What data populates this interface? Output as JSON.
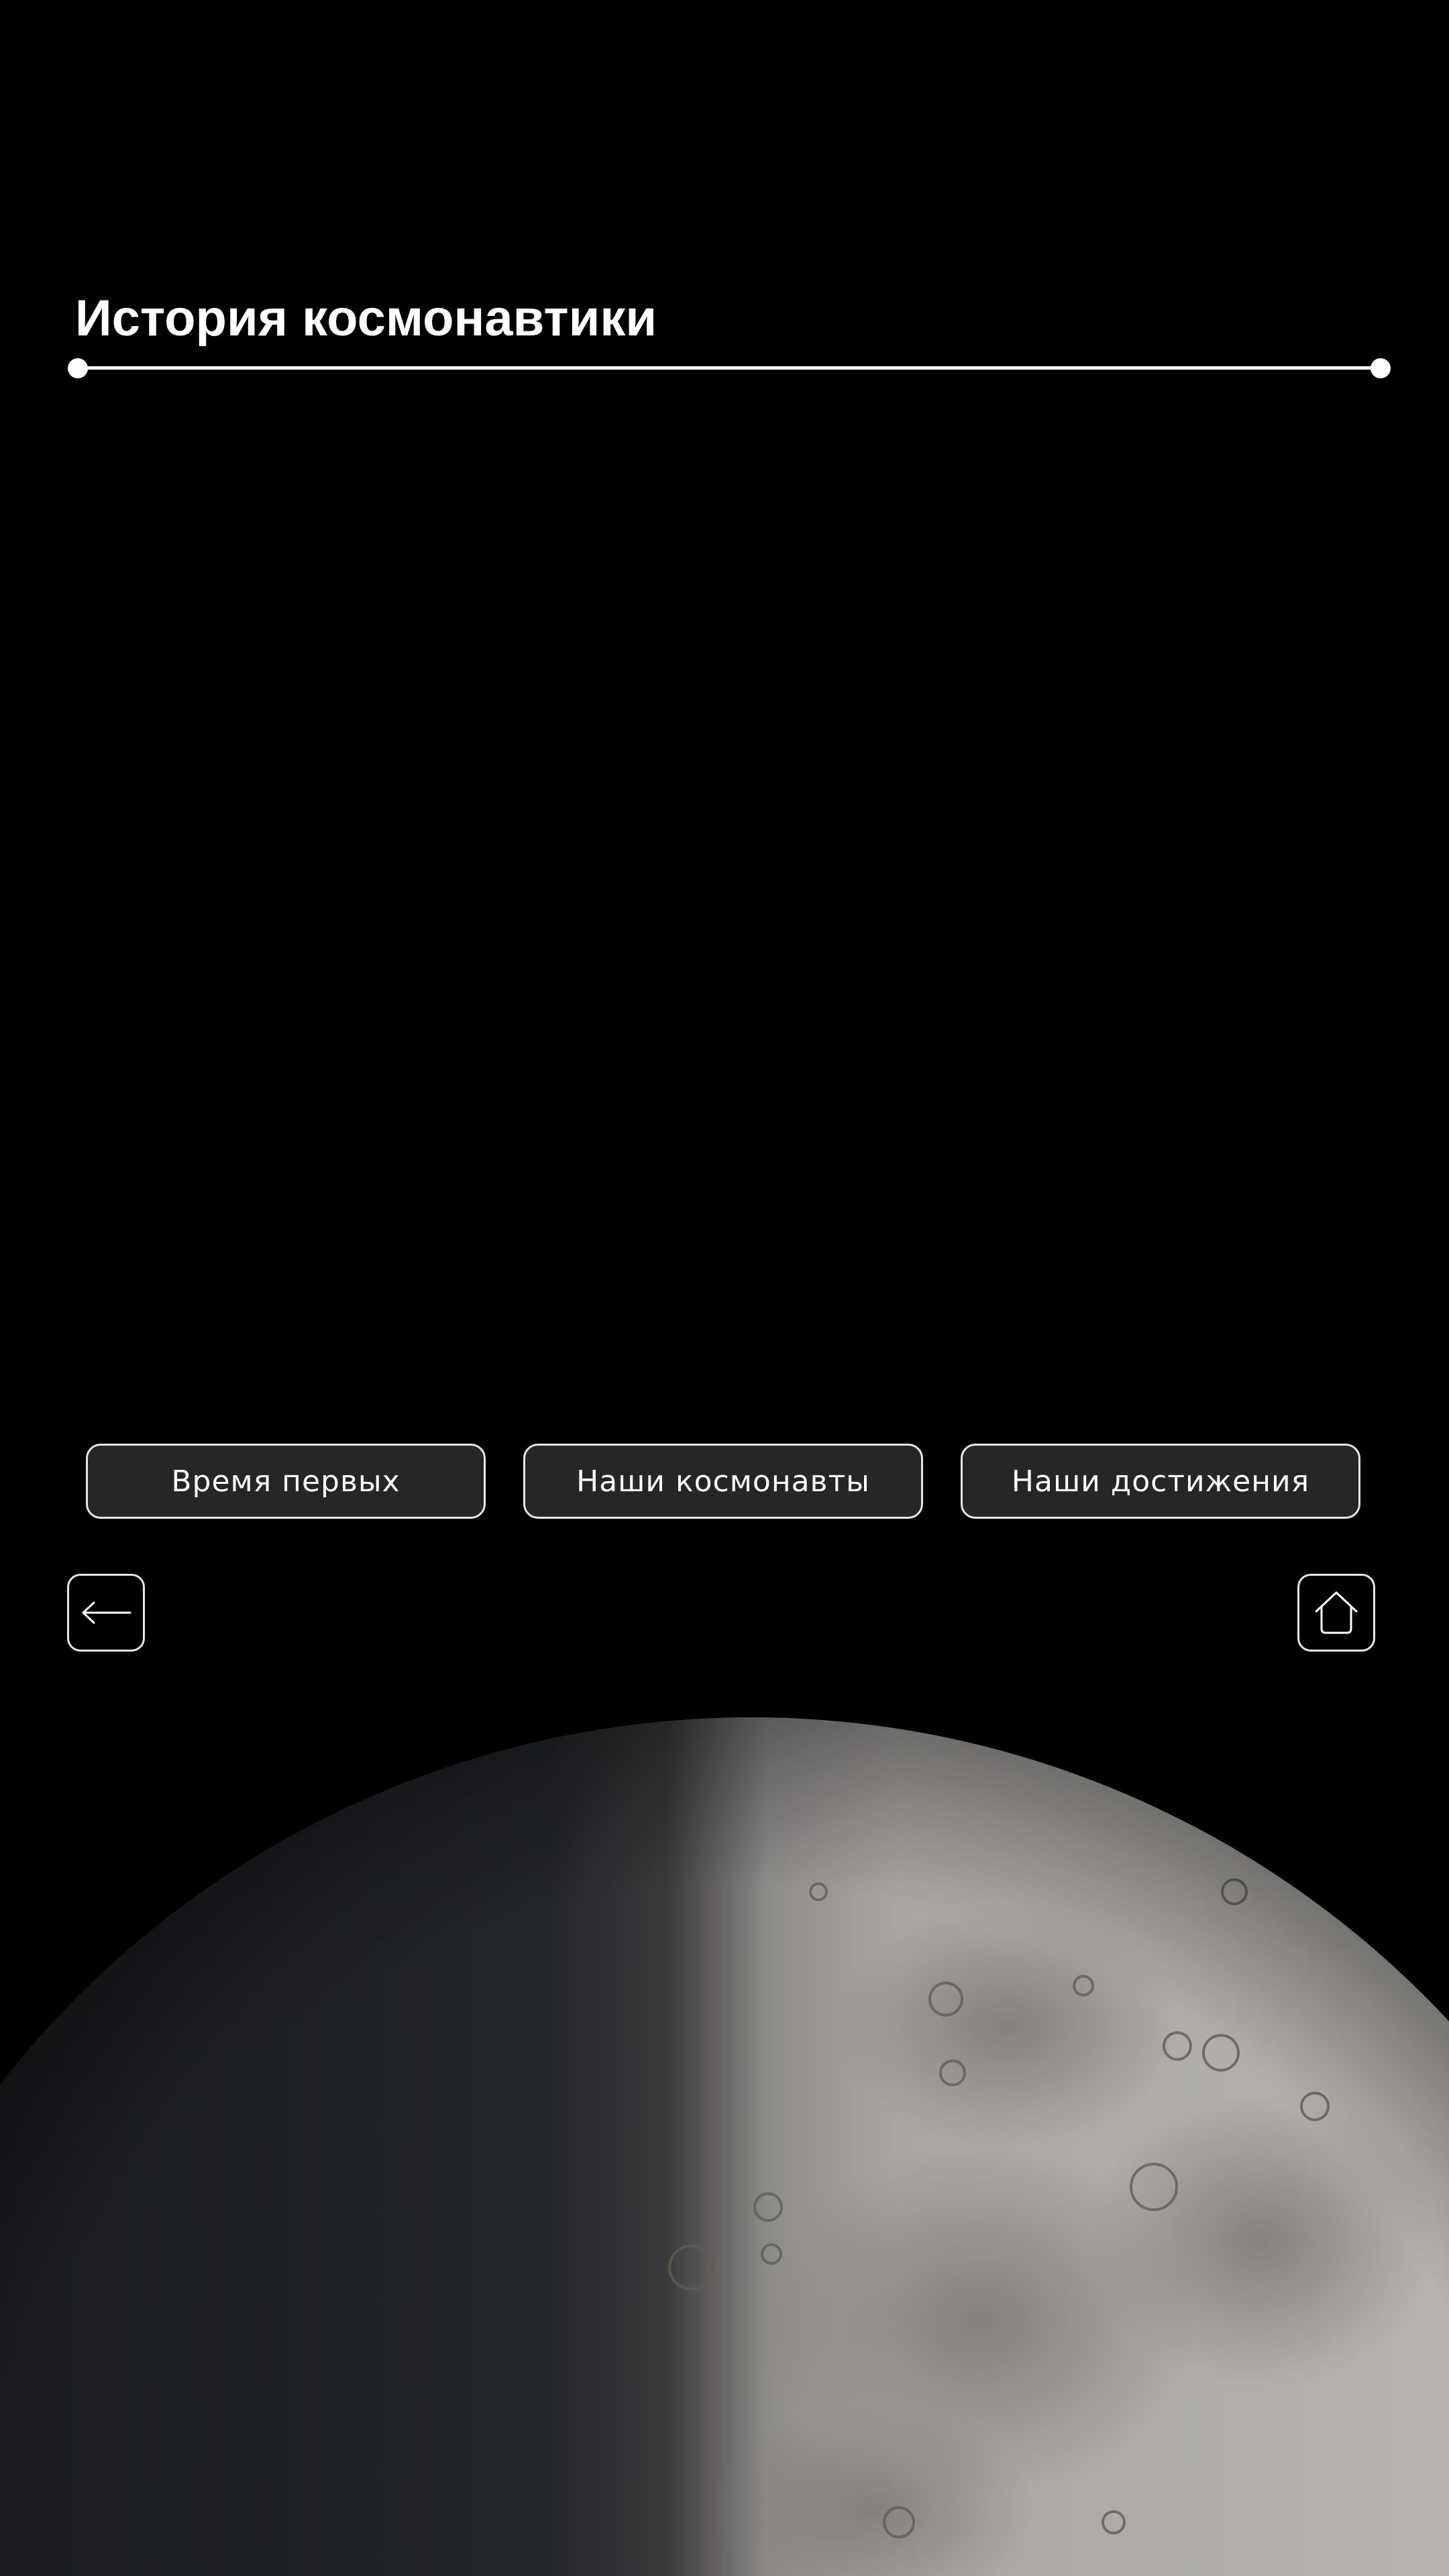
{
  "header": {
    "title": "История космонавтики"
  },
  "nav": {
    "buttons": [
      {
        "label": "Время первых"
      },
      {
        "label": "Наши космонавты"
      },
      {
        "label": "Наши достижения"
      }
    ]
  },
  "controls": {
    "back_icon": "arrow-left-icon",
    "home_icon": "home-icon"
  },
  "colors": {
    "background": "#000000",
    "button_fill": "#262626",
    "button_border": "#e6e6e6",
    "text": "#ffffff"
  }
}
